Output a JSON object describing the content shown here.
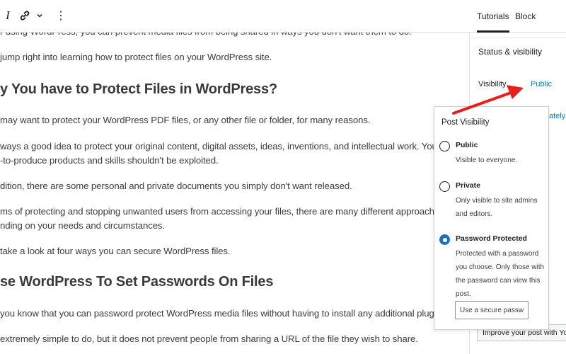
{
  "toolbar": {
    "italic_glyph": "I",
    "link_icon": "link-icon",
    "chevron_icon": "chevron-down-icon",
    "more_glyph": "⋮"
  },
  "content": {
    "top_fragment": "r using WordPress, you can prevent media files from being shared in ways you don't want them to do.",
    "p_intro": "jump right into learning how to protect files on your WordPress site.",
    "h_why": "y You have to Protect Files in WordPress?",
    "p_reasons": "may want to protect your WordPress PDF files, or any other file or folder, for many reasons.",
    "p_original": "ways a good idea to protect your original content, digital assets, ideas, inventions, and intellectual work. Your",
    "p_original_2": "-to-produce products and skills shouldn't be exploited.",
    "p_personal": "dition, there are some personal and private documents you simply don't want released.",
    "p_approaches": "ms of protecting and stopping unwanted users from accessing your files, there are many different approaches",
    "p_approaches_2": "nding on your needs and circumstances.",
    "p_four_ways": "take a look at four ways you can secure WordPress files.",
    "h_passwords": "se WordPress To Set Passwords On Files",
    "p_know": "you know that you can password protect WordPress media files without having to install any additional plugins?",
    "p_simple": "extremely simple to do, but it does not prevent people from sharing a URL of the file they wish to share."
  },
  "sidebar": {
    "tabs": [
      {
        "label": "Tutorials",
        "active": true
      },
      {
        "label": "Block",
        "active": false
      }
    ],
    "panel_title": "Status & visibility",
    "visibility_label": "Visibility",
    "visibility_value": "Public",
    "partial_link": "ately",
    "yoast_button": "Improve your post with Yoast SEO"
  },
  "popover": {
    "title": "Post Visibility",
    "options": [
      {
        "label": "Public",
        "description": "Visible to everyone.",
        "checked": false
      },
      {
        "label": "Private",
        "description": "Only visible to site admins and editors.",
        "checked": false
      },
      {
        "label": "Password Protected",
        "description": "Protected with a password you choose. Only those with the password can view this post.",
        "checked": true
      }
    ],
    "password_placeholder": "Use a secure password"
  },
  "colors": {
    "link_blue": "#007cba",
    "radio_checked": "#1e6fbf",
    "arrow_red": "#e8201c"
  }
}
